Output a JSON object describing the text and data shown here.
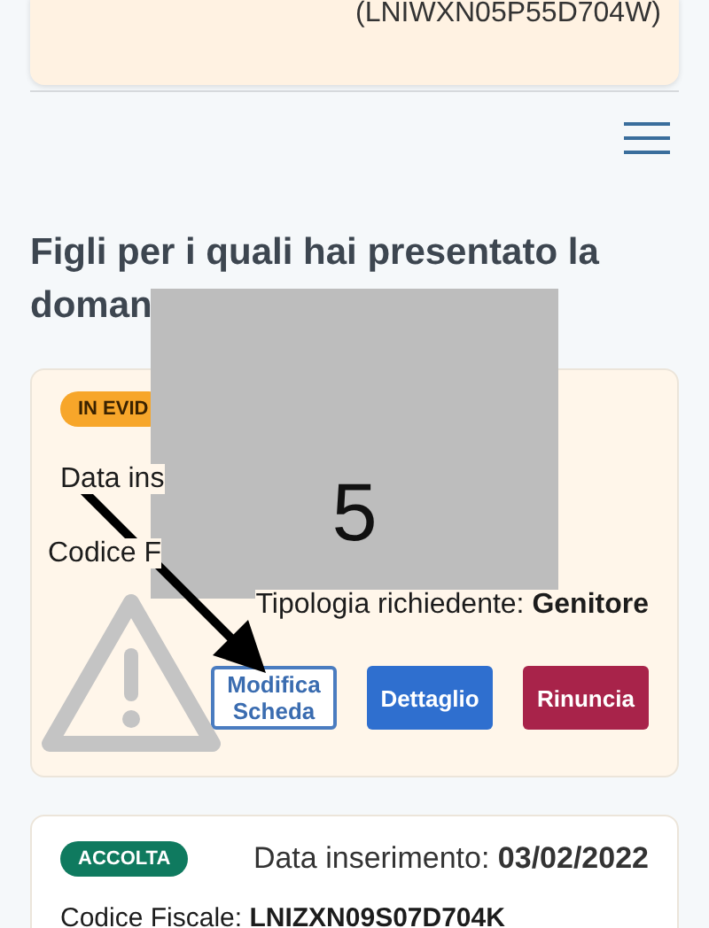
{
  "top_card": {
    "fiscal_code": "(LNIWXN05P55D704W)"
  },
  "menu_button": {
    "kind": "hamburger"
  },
  "section_title": {
    "line_1": "Figli per i quali hai presentato la",
    "line_2": "doman"
  },
  "applications": [
    {
      "status": "IN EVID",
      "color": "#f7a62a",
      "date_text": "Data ins",
      "code_text": "Codice F",
      "applicant_text": "Tipologia richiedente: **Genitore**",
      "buttons": [
        {
          "label": "Modifica Scheda",
          "kind": "outline"
        },
        {
          "label": "Dettaglio",
          "kind": "primary"
        },
        {
          "label": "Rinuncia",
          "kind": "danger"
        }
      ]
    },
    {
      "status": "ACCOLTA",
      "color": "#0f7a5f",
      "date_text": "Data inserimento: **03/02/2022**",
      "code_text": "Codice Fiscale: **LNIZXN09S07D704K**"
    }
  ],
  "overlay": {
    "label": "5"
  }
}
